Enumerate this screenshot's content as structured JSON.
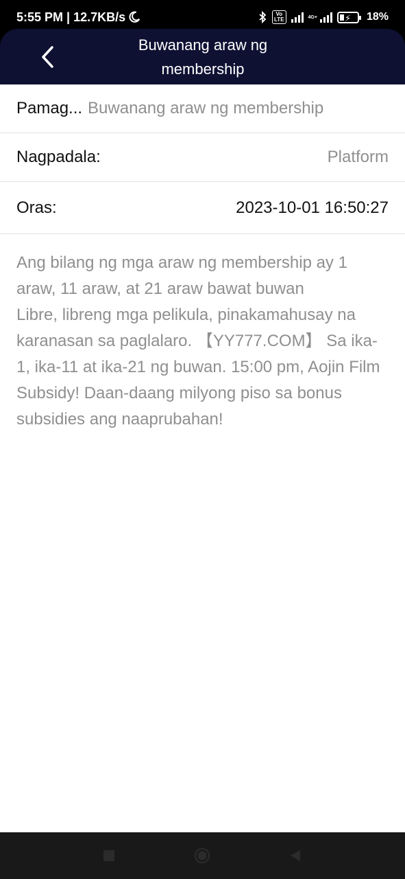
{
  "status_bar": {
    "time_speed": "5:55 PM | 12.7KB/s",
    "volte_tag": "Vo\nLTE",
    "net_type": "4G+",
    "battery": "18%",
    "battery_level": 0.18
  },
  "header": {
    "back_icon": "chevron-left-icon",
    "title_line1": "Buwanang araw ng",
    "title_line2": "membership"
  },
  "details": {
    "subject_label": "Pamag...",
    "subject_value": "Buwanang araw ng membership",
    "sender_label": "Nagpadala:",
    "sender_value": "Platform",
    "time_label": "Oras:",
    "time_value": "2023-10-01 16:50:27"
  },
  "message": {
    "line1": "Ang bilang ng mga araw ng membership ay 1 araw, 11 araw, at 21 araw bawat buwan",
    "line2": "Libre, libreng mga pelikula, pinakamahusay na karanasan sa paglalaro. 【YY777.COM】 Sa ika-1, ika-11 at ika-21 ng buwan. 15:00 pm, Aojin Film Subsidy! Daan-daang milyong piso sa bonus subsidies ang naaprubahan!"
  },
  "nav_bar": {
    "icons": [
      "square-icon",
      "home-circle-icon",
      "back-triangle-icon"
    ]
  }
}
